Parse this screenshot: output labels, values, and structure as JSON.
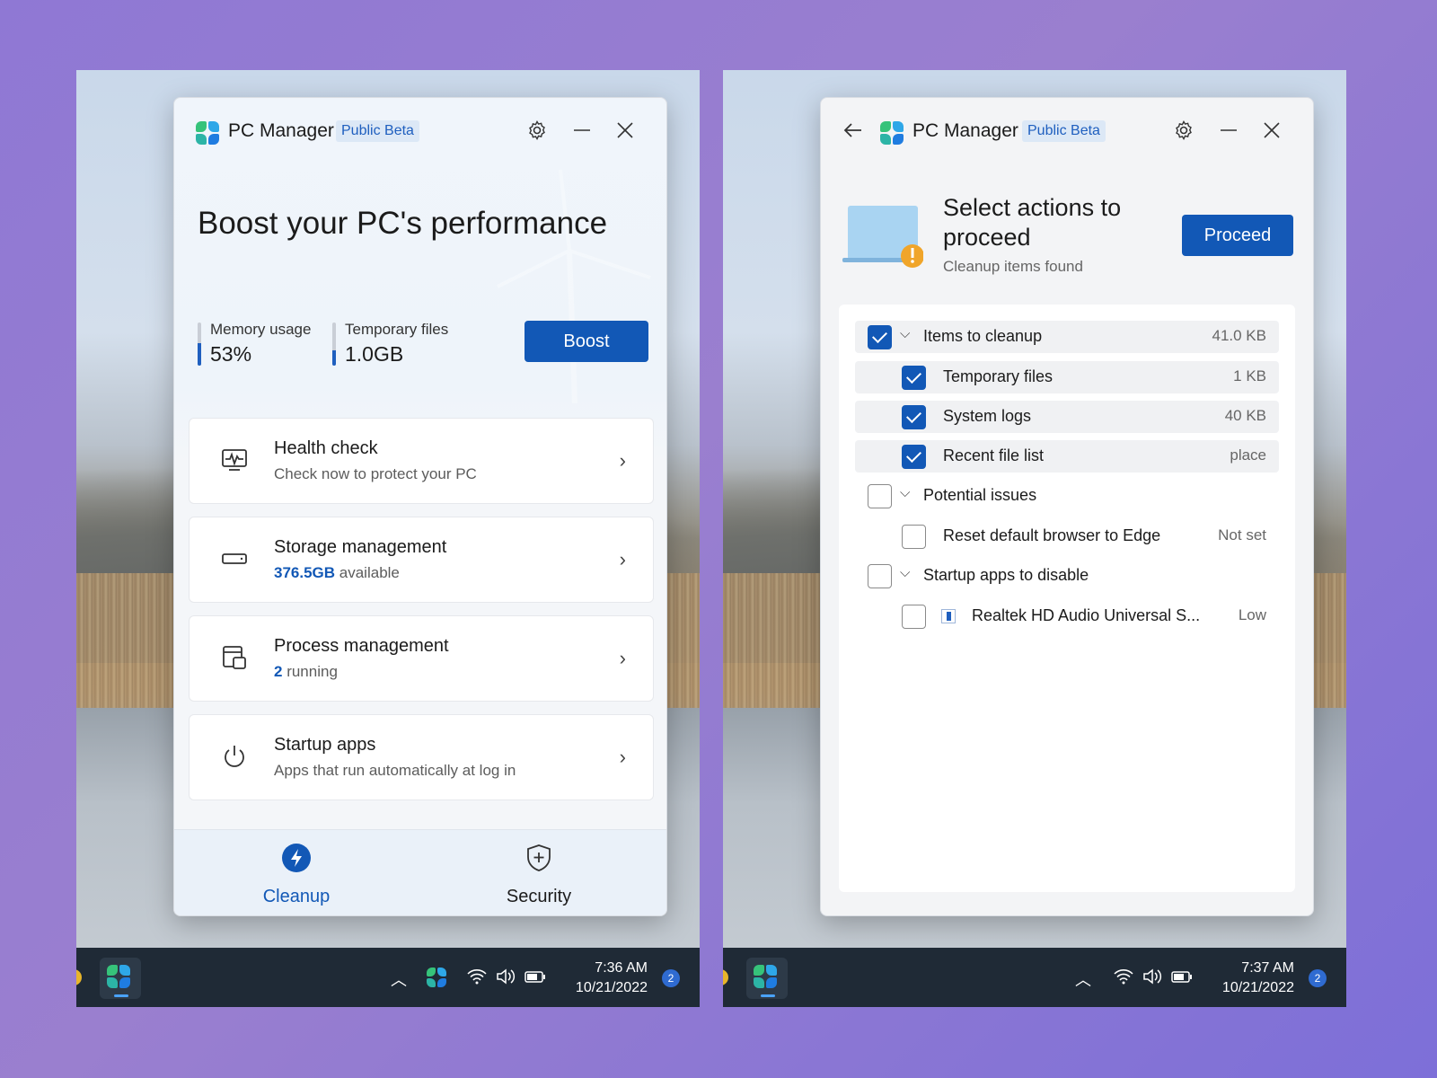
{
  "left": {
    "app_title": "PC Manager",
    "beta_label": "Public Beta",
    "hero_title": "Boost your PC's performance",
    "metrics": [
      {
        "label": "Memory usage",
        "value": "53%",
        "level": 0.53
      },
      {
        "label": "Temporary files",
        "value": "1.0GB",
        "level": 0.35
      }
    ],
    "boost_label": "Boost",
    "cards": [
      {
        "title": "Health check",
        "sub_plain": "Check now to protect your PC",
        "icon": "health-monitor-icon"
      },
      {
        "title": "Storage management",
        "sub_bold": "376.5GB",
        "sub_plain": " available",
        "icon": "storage-drive-icon"
      },
      {
        "title": "Process management",
        "sub_bold": "2",
        "sub_plain": " running",
        "icon": "process-window-icon"
      },
      {
        "title": "Startup apps",
        "sub_plain": "Apps that run automatically at log in",
        "icon": "power-icon"
      }
    ],
    "nav": [
      {
        "label": "Cleanup",
        "icon": "lightning-icon",
        "active": true
      },
      {
        "label": "Security",
        "icon": "shield-icon",
        "active": false
      }
    ],
    "clock": {
      "time": "7:36 AM",
      "date": "10/21/2022"
    },
    "badge": "2"
  },
  "right": {
    "app_title": "PC Manager",
    "beta_label": "Public Beta",
    "select_title": "Select actions to proceed",
    "select_sub": "Cleanup items found",
    "proceed_label": "Proceed",
    "groups": {
      "cleanup": {
        "label": "Items to cleanup",
        "value": "41.0 KB",
        "checked": true,
        "items": [
          {
            "label": "Temporary files",
            "value": "1 KB",
            "checked": true
          },
          {
            "label": "System logs",
            "value": "40 KB",
            "checked": true
          },
          {
            "label": "Recent file list",
            "value": "place",
            "checked": true
          }
        ]
      },
      "issues": {
        "label": "Potential issues",
        "checked": false,
        "items": [
          {
            "label": "Reset default browser to Edge",
            "value": "Not set",
            "checked": false
          }
        ]
      },
      "startup": {
        "label": "Startup apps to disable",
        "checked": false,
        "items": [
          {
            "label": "Realtek HD Audio Universal S...",
            "value": "Low",
            "checked": false
          }
        ]
      }
    },
    "clock": {
      "time": "7:37 AM",
      "date": "10/21/2022"
    },
    "badge": "2"
  },
  "colors": {
    "accent": "#1258b6",
    "background": "#9a7fcf",
    "taskbar": "#1f2a36"
  }
}
